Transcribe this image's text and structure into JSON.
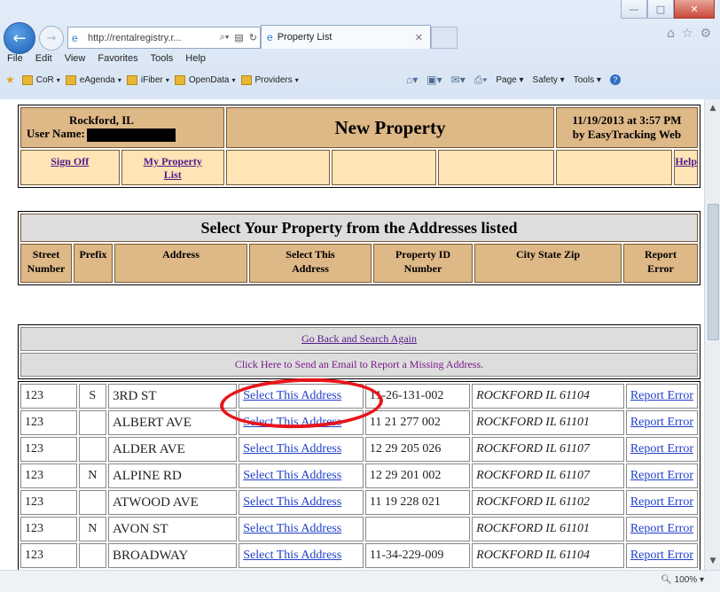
{
  "browser": {
    "url": "http://rentalregistry.r...",
    "tab_title": "Property List",
    "menu": [
      "File",
      "Edit",
      "View",
      "Favorites",
      "Tools",
      "Help"
    ],
    "favorites": [
      "CoR",
      "eAgenda",
      "iFiber",
      "OpenData",
      "Providers"
    ],
    "commands": [
      "Page",
      "Safety",
      "Tools"
    ],
    "zoom": "100%"
  },
  "header": {
    "city": "Rockford, IL",
    "user_label": "User Name:",
    "title": "New Property",
    "date": "11/19/2013 at 3:57 PM",
    "byline": "by EasyTracking Web",
    "nav": {
      "sign_off": "Sign Off",
      "my_property_1": "My Property",
      "my_property_2": "List",
      "help": "Help"
    }
  },
  "select_table": {
    "title": "Select Your Property from the Addresses listed",
    "columns": [
      [
        "Street",
        "Number"
      ],
      [
        "Prefix",
        ""
      ],
      [
        "Address",
        ""
      ],
      [
        "Select This",
        "Address"
      ],
      [
        "Property ID",
        "Number"
      ],
      [
        "City State Zip",
        ""
      ],
      [
        "Report",
        "Error"
      ]
    ]
  },
  "actions": {
    "go_back": "Go Back and Search Again",
    "email": "Click Here to Send an Email to Report a Missing Address."
  },
  "results": [
    {
      "num": "123",
      "prefix": "S",
      "address": "3RD ST",
      "select": "Select This Address",
      "pid": "11-26-131-002",
      "csz": "ROCKFORD IL 61104",
      "report": "Report Error"
    },
    {
      "num": "123",
      "prefix": "",
      "address": "ALBERT AVE",
      "select": "Select This Address",
      "pid": "11 21 277 002",
      "csz": "ROCKFORD IL 61101",
      "report": "Report Error"
    },
    {
      "num": "123",
      "prefix": "",
      "address": "ALDER AVE",
      "select": "Select This Address",
      "pid": "12 29 205 026",
      "csz": "ROCKFORD IL 61107",
      "report": "Report Error"
    },
    {
      "num": "123",
      "prefix": "N",
      "address": "ALPINE RD",
      "select": "Select This Address",
      "pid": "12 29 201 002",
      "csz": "ROCKFORD IL 61107",
      "report": "Report Error"
    },
    {
      "num": "123",
      "prefix": "",
      "address": "ATWOOD AVE",
      "select": "Select This Address",
      "pid": "11 19 228 021",
      "csz": "ROCKFORD IL 61102",
      "report": "Report Error"
    },
    {
      "num": "123",
      "prefix": "N",
      "address": "AVON ST",
      "select": "Select This Address",
      "pid": "",
      "csz": "ROCKFORD IL 61101",
      "report": "Report Error"
    },
    {
      "num": "123",
      "prefix": "",
      "address": "BROADWAY",
      "select": "Select This Address",
      "pid": "11-34-229-009",
      "csz": "ROCKFORD IL 61104",
      "report": "Report Error"
    }
  ],
  "icons": {
    "back": "back-arrow-icon",
    "forward": "forward-arrow-icon",
    "home": "home-icon",
    "favorites": "star-icon",
    "settings": "gear-icon",
    "help": "help-icon"
  },
  "colors": {
    "header_tan": "#deb887",
    "nav_cream": "#ffe4b5",
    "highlight_circle": "#e8141b"
  }
}
